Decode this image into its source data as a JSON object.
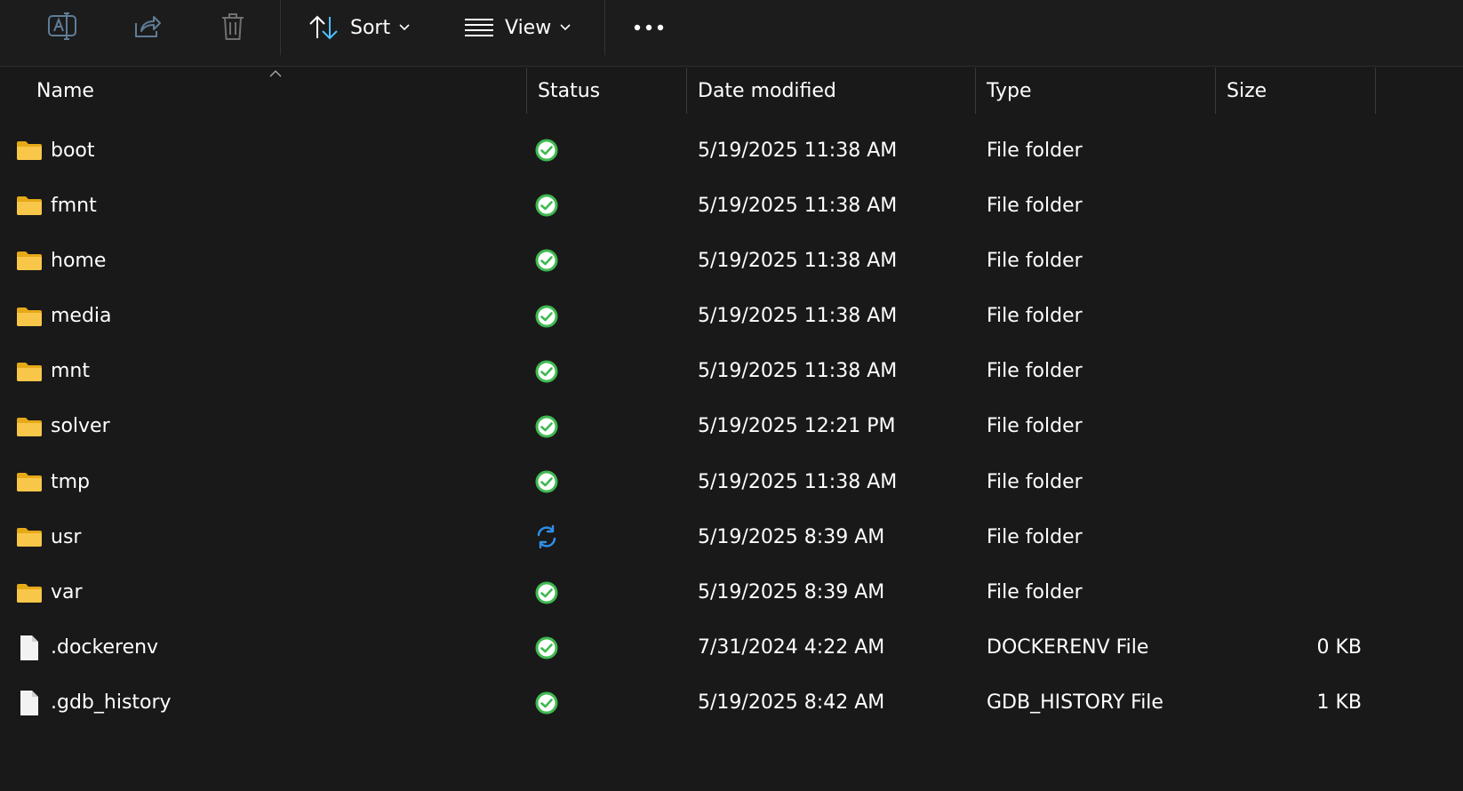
{
  "toolbar": {
    "sort_label": "Sort",
    "view_label": "View",
    "icons": [
      "rename-icon",
      "share-icon",
      "delete-icon",
      "sort-icon",
      "view-icon",
      "more-icon"
    ]
  },
  "columns": {
    "name": "Name",
    "status": "Status",
    "date": "Date modified",
    "type": "Type",
    "size": "Size"
  },
  "colors": {
    "background": "#191919",
    "folder": "#f8c74a",
    "synced": "#3fb950",
    "syncing": "#2f8fe8"
  },
  "rows": [
    {
      "name": "boot",
      "icon": "folder-icon",
      "status": "synced",
      "date": "5/19/2025 11:38 AM",
      "type": "File folder",
      "size": ""
    },
    {
      "name": "fmnt",
      "icon": "folder-icon",
      "status": "synced",
      "date": "5/19/2025 11:38 AM",
      "type": "File folder",
      "size": ""
    },
    {
      "name": "home",
      "icon": "folder-icon",
      "status": "synced",
      "date": "5/19/2025 11:38 AM",
      "type": "File folder",
      "size": ""
    },
    {
      "name": "media",
      "icon": "folder-icon",
      "status": "synced",
      "date": "5/19/2025 11:38 AM",
      "type": "File folder",
      "size": ""
    },
    {
      "name": "mnt",
      "icon": "folder-icon",
      "status": "synced",
      "date": "5/19/2025 11:38 AM",
      "type": "File folder",
      "size": ""
    },
    {
      "name": "solver",
      "icon": "folder-icon",
      "status": "synced",
      "date": "5/19/2025 12:21 PM",
      "type": "File folder",
      "size": ""
    },
    {
      "name": "tmp",
      "icon": "folder-icon",
      "status": "synced",
      "date": "5/19/2025 11:38 AM",
      "type": "File folder",
      "size": ""
    },
    {
      "name": "usr",
      "icon": "folder-icon",
      "status": "syncing",
      "date": "5/19/2025 8:39 AM",
      "type": "File folder",
      "size": ""
    },
    {
      "name": "var",
      "icon": "folder-icon",
      "status": "synced",
      "date": "5/19/2025 8:39 AM",
      "type": "File folder",
      "size": ""
    },
    {
      "name": ".dockerenv",
      "icon": "file-icon",
      "status": "synced",
      "date": "7/31/2024 4:22 AM",
      "type": "DOCKERENV File",
      "size": "0 KB"
    },
    {
      "name": ".gdb_history",
      "icon": "file-icon",
      "status": "synced",
      "date": "5/19/2025 8:42 AM",
      "type": "GDB_HISTORY File",
      "size": "1 KB"
    }
  ]
}
